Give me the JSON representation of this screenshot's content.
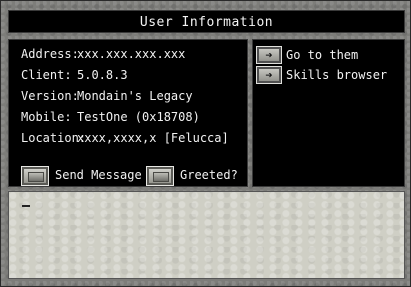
{
  "title": "User Information",
  "fields": [
    {
      "label": "Address:",
      "value": "xxx.xxx.xxx.xxx"
    },
    {
      "label": "Client:",
      "value": "5.0.8.3"
    },
    {
      "label": "Version:",
      "value": "Mondain's Legacy"
    },
    {
      "label": "Mobile:",
      "value": "TestOne (0x18708)"
    },
    {
      "label": "Location:",
      "value": "xxxx,xxxx,x [Felucca]"
    }
  ],
  "actions": {
    "send_message": "Send Message",
    "greeted": "Greeted?"
  },
  "side_actions": [
    {
      "label": "Go to them"
    },
    {
      "label": "Skills browser"
    }
  ],
  "icons": {
    "button": "gump-button-icon",
    "arrow": "right-arrow-icon"
  },
  "message": {
    "value": ""
  }
}
